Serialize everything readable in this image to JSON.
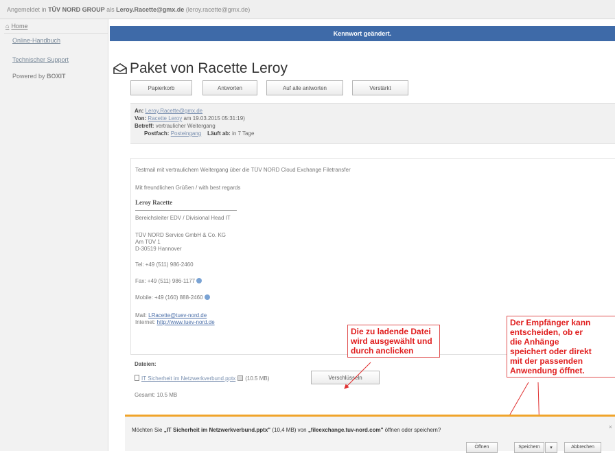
{
  "topbar": {
    "text_prefix": "Angemeldet in",
    "org": "TÜV NORD GROUP",
    "text_as": "als",
    "user": "Leroy.Racette@gmx.de",
    "email_paren": "(leroy.racette@gmx.de)"
  },
  "sidebar": {
    "home": "Home",
    "online_handbuch": "Online-Handbuch",
    "tech_support": "Technischer Support",
    "powered_prefix": "Powered by",
    "powered_brand": "BOXIT"
  },
  "banner": {
    "text": "Kennwort geändert."
  },
  "message": {
    "title": "Paket von Racette Leroy",
    "buttons": [
      "Papierkorb",
      "Antworten",
      "Auf alle antworten",
      "Verstärkt"
    ],
    "header": {
      "to_label": "An:",
      "to_value": "Leroy.Racette@gmx.de",
      "from_label": "Von:",
      "from_value": "Racette Leroy",
      "from_date": "am 19.03.2015 05:31:19)",
      "subject_label": "Betreff:",
      "subject_value": "vertraulicher Weitergang",
      "postfach_label": "Postfach:",
      "postfach_value": "Posteingang",
      "expires_label": "Läuft ab:",
      "expires_value": "in 7 Tage"
    },
    "body": {
      "line1": "Testmail mit vertraulichem Weitergang über die TÜV NORD Cloud Exchange Filetransfer",
      "greeting": "Mit freundlichen Grüßen / with best regards",
      "sig_name": "Leroy Racette",
      "dept": "Bereichsleiter EDV / Divisional Head IT",
      "company": "TÜV NORD Service GmbH & Co. KG",
      "street": "Am TÜV 1",
      "city": "D-30519 Hannover",
      "tel": "Tel: +49 (511) 986-2460",
      "fax": "Fax: +49 (511) 986-1177",
      "mobile": "Mobile: +49 (160) 888-2460",
      "mail_label": "Mail:",
      "mail_value": "LRacette@tuev-nord.de",
      "web_label": "Internet:",
      "web_value": "http://www.tuev-nord.de"
    },
    "attachments": {
      "label": "Dateien:",
      "file_name": "IT Sicherheit im Netzwerkverbund.pptx",
      "file_size": "(10.5 MB)",
      "verify_button": "Verschlüsseln",
      "total": "Gesamt: 10.5 MB"
    }
  },
  "callouts": {
    "select_file": [
      "Die zu ladende Datei",
      "wird ausgewählt und",
      "durch anclicken"
    ],
    "recipient": [
      "Der Empfänger kann",
      "entscheiden, ob er",
      "die Anhänge",
      "speichert oder direkt",
      "mit der passenden",
      "Anwendung öffnet."
    ]
  },
  "download_bar": {
    "msg_prefix": "Möchten Sie",
    "file": "„IT Sicherheit im Netzwerkverbund.pptx\"",
    "msg_mid": "(10,4 MB) von",
    "host": "„fileexchange.tuv-nord.com\"",
    "msg_suffix": "öffnen oder speichern?",
    "open": "Öffnen",
    "save": "Speichern",
    "dropdown": "▾",
    "cancel": "Abbrechen",
    "close": "×"
  },
  "colors": {
    "banner": "#3e6aa8",
    "callout_text": "#e01e1e",
    "download_accent": "#f0a42a"
  }
}
